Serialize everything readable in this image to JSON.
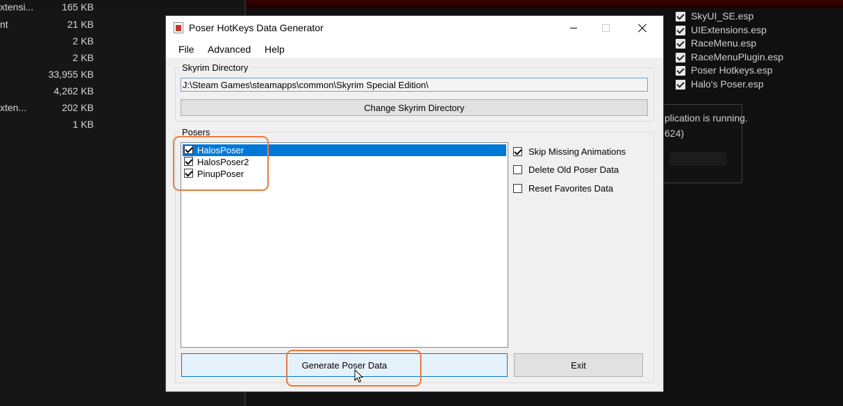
{
  "files": [
    {
      "name": "xtensi...",
      "size": "165 KB"
    },
    {
      "name": "nt",
      "size": "21 KB"
    },
    {
      "name": "",
      "size": "2 KB"
    },
    {
      "name": "",
      "size": "2 KB"
    },
    {
      "name": "",
      "size": "33,955 KB"
    },
    {
      "name": "",
      "size": "4,262 KB"
    },
    {
      "name": "xten...",
      "size": "202 KB"
    },
    {
      "name": "",
      "size": "1 KB"
    }
  ],
  "plugins": [
    {
      "label": "SkyUI_SE.esp"
    },
    {
      "label": "UIExtensions.esp"
    },
    {
      "label": "RaceMenu.esp"
    },
    {
      "label": "RaceMenuPlugin.esp"
    },
    {
      "label": "Poser Hotkeys.esp"
    },
    {
      "label": "Halo's Poser.esp"
    }
  ],
  "notice": {
    "line1": "plication is running.",
    "line2": "624)"
  },
  "window": {
    "title": "Poser HotKeys Data Generator",
    "menu": [
      "File",
      "Advanced",
      "Help"
    ]
  },
  "skyrim": {
    "group_label": "Skyrim Directory",
    "path": "J:\\Steam Games\\steamapps\\common\\Skyrim Special Edition\\",
    "change_button": "Change Skyrim Directory"
  },
  "posers": {
    "group_label": "Posers",
    "items": [
      {
        "label": "HalosPoser",
        "checked": true,
        "selected": true
      },
      {
        "label": "HalosPoser2",
        "checked": true,
        "selected": false
      },
      {
        "label": "PinupPoser",
        "checked": true,
        "selected": false
      }
    ]
  },
  "options": [
    {
      "label": "Skip Missing Animations",
      "checked": true
    },
    {
      "label": "Delete Old Poser Data",
      "checked": false
    },
    {
      "label": "Reset Favorites Data",
      "checked": false
    }
  ],
  "buttons": {
    "generate": "Generate Poser Data",
    "exit": "Exit"
  },
  "colors": {
    "selection": "#0078d7",
    "highlight": "#e87a3b",
    "topbar": "#3a0000"
  }
}
